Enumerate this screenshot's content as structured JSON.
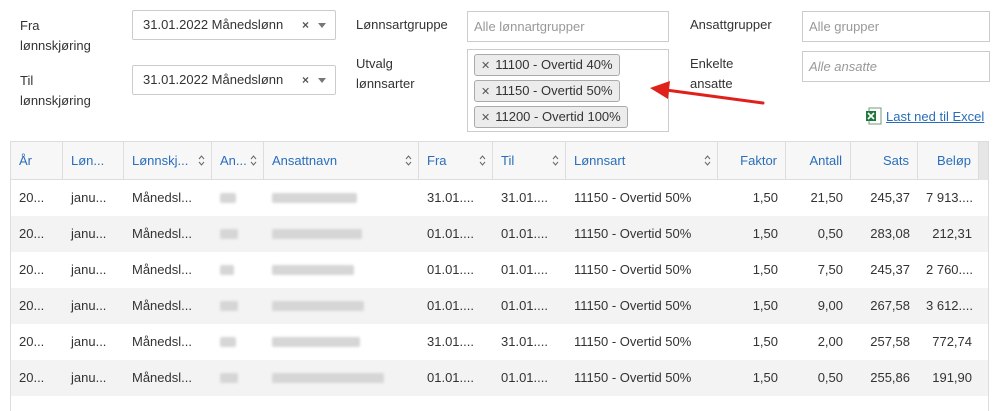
{
  "filters": {
    "fra_label": "Fra\nlønnskjøring",
    "fra_value": "31.01.2022 Månedslønn",
    "til_label": "Til\nlønnskjøring",
    "til_value": "31.01.2022 Månedslønn",
    "lonnsartgruppe_label": "Lønnsartgruppe",
    "lonnsartgruppe_placeholder": "Alle lønnartgrupper",
    "utvalg_label": "Utvalg\nlønnsarter",
    "utvalg_tags": [
      "11100 - Overtid 40%",
      "11150 - Overtid 50%",
      "11200 - Overtid 100%"
    ],
    "ansattgrupper_label": "Ansattgrupper",
    "ansattgrupper_placeholder": "Alle grupper",
    "enkelte_label": "Enkelte\nansatte",
    "enkelte_placeholder": "Alle ansatte"
  },
  "export": {
    "label": "Last ned til Excel",
    "icon": "excel-icon"
  },
  "colors": {
    "link": "#2a6ebb",
    "arrow": "#e0201b",
    "excel": "#1f7a3a"
  },
  "table": {
    "columns": [
      "År",
      "Løn...",
      "Lønnskj...",
      "An...",
      "Ansattnavn",
      "Fra",
      "Til",
      "Lønnsart",
      "Faktor",
      "Antall",
      "Sats",
      "Beløp"
    ],
    "rows": [
      [
        "20...",
        "janu...",
        "Månedsl...",
        "",
        "",
        "31.01....",
        "31.01....",
        "11150 - Overtid 50%",
        "1,50",
        "21,50",
        "245,37",
        "7 913...."
      ],
      [
        "20...",
        "janu...",
        "Månedsl...",
        "",
        "",
        "01.01....",
        "01.01....",
        "11150 - Overtid 50%",
        "1,50",
        "0,50",
        "283,08",
        "212,31"
      ],
      [
        "20...",
        "janu...",
        "Månedsl...",
        "",
        "",
        "01.01....",
        "01.01....",
        "11150 - Overtid 50%",
        "1,50",
        "7,50",
        "245,37",
        "2 760...."
      ],
      [
        "20...",
        "janu...",
        "Månedsl...",
        "",
        "",
        "01.01....",
        "01.01....",
        "11150 - Overtid 50%",
        "1,50",
        "9,00",
        "267,58",
        "3 612...."
      ],
      [
        "20...",
        "janu...",
        "Månedsl...",
        "",
        "",
        "31.01....",
        "31.01....",
        "11150 - Overtid 50%",
        "1,50",
        "2,00",
        "257,58",
        "772,74"
      ],
      [
        "20...",
        "janu...",
        "Månedsl...",
        "",
        "",
        "01.01....",
        "01.01....",
        "11150 - Overtid 50%",
        "1,50",
        "0,50",
        "255,86",
        "191,90"
      ]
    ]
  }
}
